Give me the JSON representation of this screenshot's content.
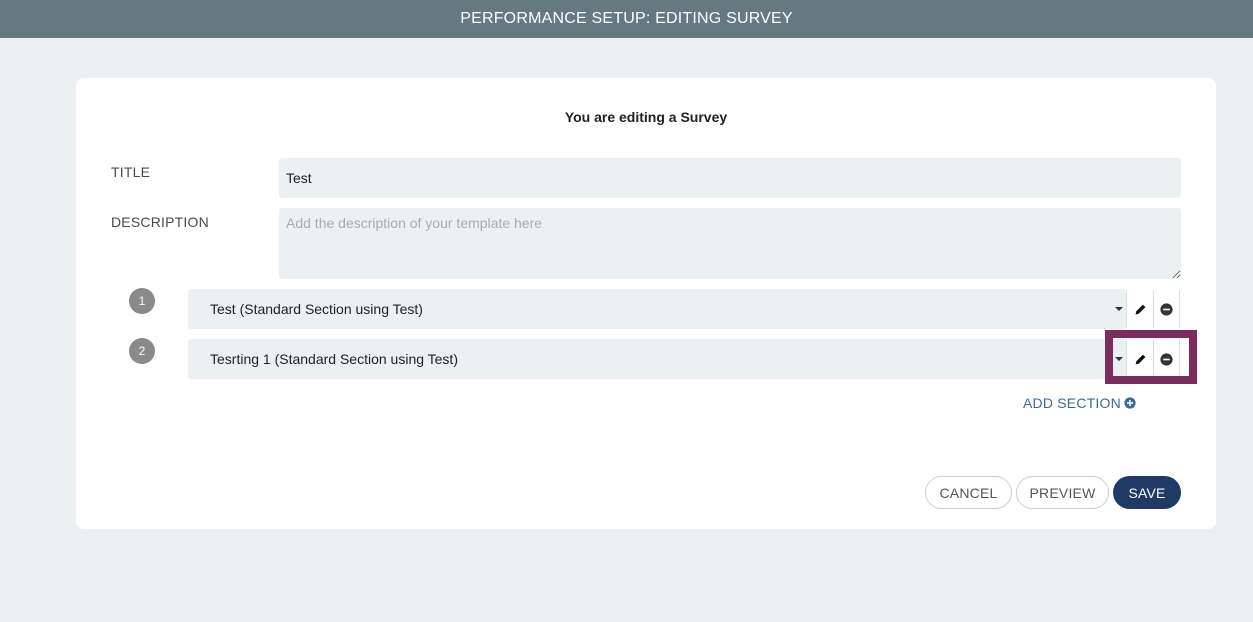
{
  "header": {
    "title": "PERFORMANCE SETUP: EDITING SURVEY"
  },
  "card": {
    "heading": "You are editing a Survey",
    "title_label": "TITLE",
    "title_value": "Test",
    "description_label": "DESCRIPTION",
    "description_placeholder": "Add the description of your template here",
    "description_value": ""
  },
  "sections": [
    {
      "number": "1",
      "label": "Test (Standard Section using Test)"
    },
    {
      "number": "2",
      "label": "Tesrting 1 (Standard Section using Test)"
    }
  ],
  "add_section_label": "ADD SECTION",
  "buttons": {
    "cancel": "CANCEL",
    "preview": "PREVIEW",
    "save": "SAVE"
  },
  "colors": {
    "header_bg": "#667880",
    "page_bg": "#ebf0f2",
    "accent": "#3d6a97",
    "save_bg": "#1f3a66",
    "highlight": "#7a2c5d"
  },
  "icons": {
    "edit": "pencil-icon",
    "remove": "minus-circle-icon",
    "dropdown": "caret-down-icon",
    "add": "plus-circle-icon"
  }
}
